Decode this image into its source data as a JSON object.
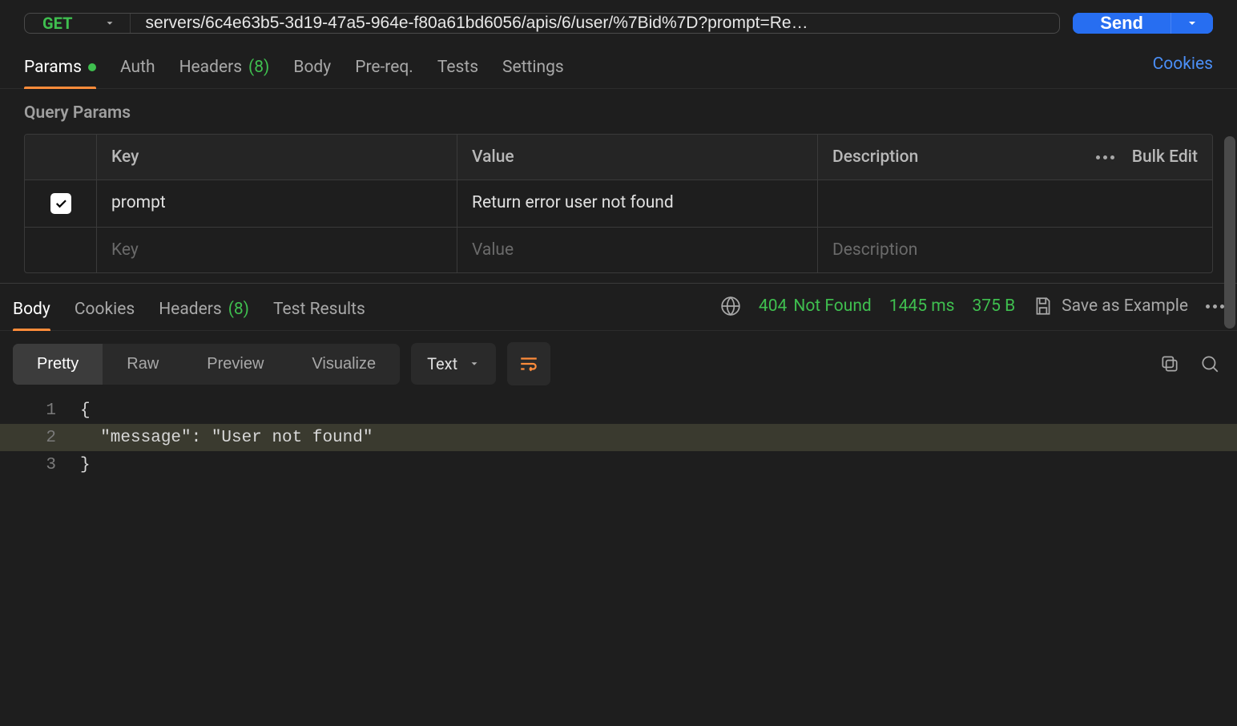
{
  "request": {
    "method": "GET",
    "url": "servers/6c4e63b5-3d19-47a5-964e-f80a61bd6056/apis/6/user/%7Bid%7D?prompt=Re…",
    "send_label": "Send"
  },
  "req_tabs": {
    "params": "Params",
    "auth": "Auth",
    "headers": "Headers",
    "headers_count": "(8)",
    "body": "Body",
    "prereq": "Pre-req.",
    "tests": "Tests",
    "settings": "Settings"
  },
  "cookies_link": "Cookies",
  "query_params": {
    "title": "Query Params",
    "columns": {
      "key": "Key",
      "value": "Value",
      "description": "Description"
    },
    "bulk_edit": "Bulk Edit",
    "rows": [
      {
        "enabled": true,
        "key": "prompt",
        "value": "Return error user not found",
        "description": ""
      }
    ],
    "placeholders": {
      "key": "Key",
      "value": "Value",
      "description": "Description"
    }
  },
  "resp_tabs": {
    "body": "Body",
    "cookies": "Cookies",
    "headers": "Headers",
    "headers_count": "(8)",
    "test_results": "Test Results"
  },
  "response_meta": {
    "status_code": "404",
    "status_text": "Not Found",
    "time": "1445 ms",
    "size": "375 B",
    "save_example": "Save as Example"
  },
  "view_controls": {
    "pretty": "Pretty",
    "raw": "Raw",
    "preview": "Preview",
    "visualize": "Visualize",
    "format": "Text"
  },
  "response_body": {
    "line1_num": "1",
    "line1": "{",
    "line2_num": "2",
    "line2": "  \"message\": \"User not found\"",
    "line3_num": "3",
    "line3": "}"
  }
}
